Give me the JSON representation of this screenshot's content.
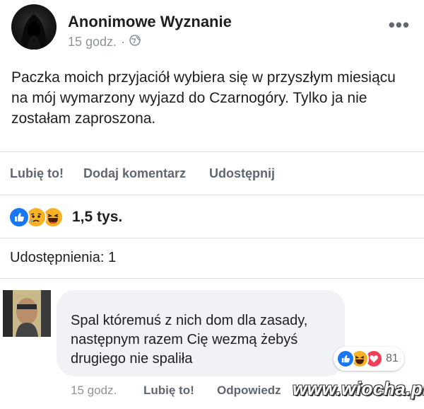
{
  "post": {
    "author": "Anonimowe Wyznanie",
    "time": "15 godz.",
    "separator": "·",
    "privacy_icon": "globe-icon",
    "more_label": "•••",
    "text": "Paczka moich przyjaciół wybiera się w przyszłym miesiącu na mój wymarzony wyjazd do Czarnogóry. Tylko ja nie zostałam zaproszona."
  },
  "actions": {
    "like": "Lubię to!",
    "comment": "Dodaj komentarz",
    "share": "Udostępnij"
  },
  "reactions": {
    "icons": [
      "like-icon",
      "sad-icon",
      "haha-icon"
    ],
    "count": "1,5 tys."
  },
  "shares": {
    "label": "Udostępnienia: 1"
  },
  "comment": {
    "text": "Spal któremuś z nich dom dla zasady, następnym razem Cię wezmą żebyś drugiego nie spaliła",
    "reactions_icons": [
      "like-icon",
      "haha-icon",
      "love-icon"
    ],
    "reactions_count": "81",
    "time": "15 godz.",
    "like_label": "Lubię to!",
    "reply_label": "Odpowiedz"
  },
  "watermark": "www.wiocha.pl",
  "colors": {
    "like_blue": "#1877f2",
    "emoji_yellow": "#f7b125",
    "love_red": "#f33e58",
    "secondary_text": "#606770",
    "muted_text": "#8d949e"
  }
}
